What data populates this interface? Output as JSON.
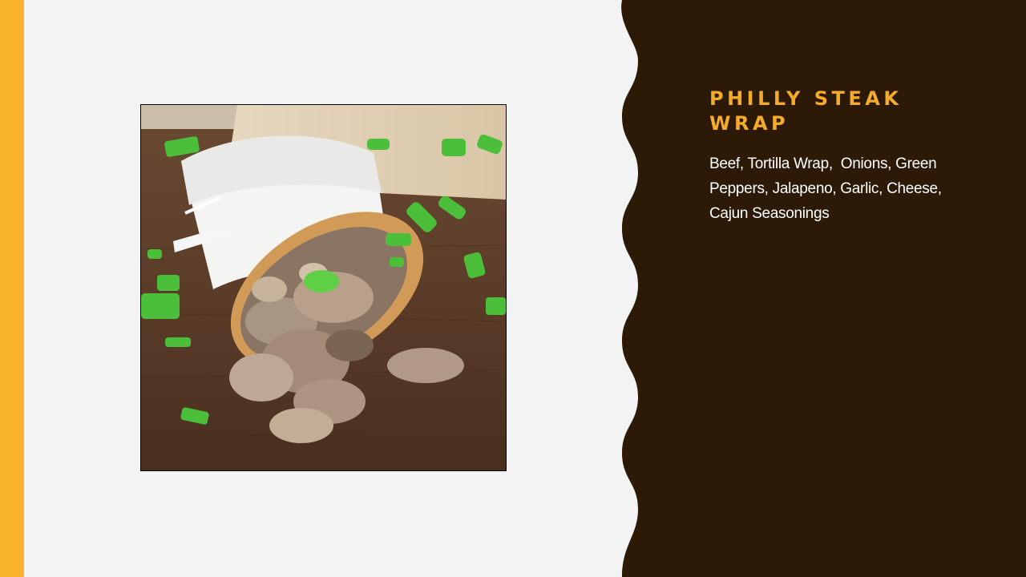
{
  "slide": {
    "title": "PHILLY STEAK WRAP",
    "body": "Beef, Tortilla Wrap,  Onions, Green Peppers, Jalapeno, Garlic, Cheese, Cajun Seasonings"
  },
  "photo": {
    "subject": "philly-steak-wrap-photo"
  },
  "colors": {
    "accent": "#f7b32b",
    "panel": "#2c1a07",
    "background": "#f3f3f3",
    "title": "#f4aa2a",
    "body_text": "#ffffff"
  }
}
